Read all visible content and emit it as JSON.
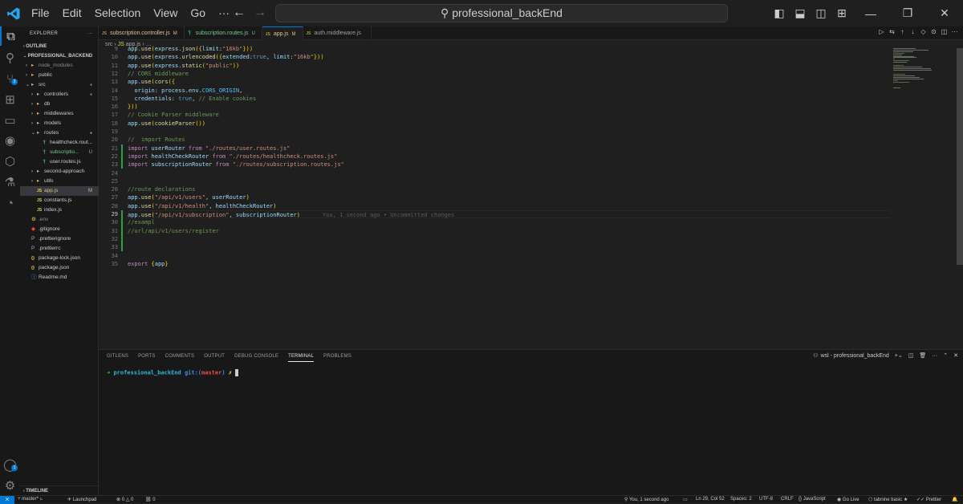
{
  "titlebar": {
    "menu": [
      "File",
      "Edit",
      "Selection",
      "View",
      "Go",
      "···"
    ],
    "search": "professional_backEnd"
  },
  "activitybar": {
    "badge_scm": "3",
    "badge_account": "1"
  },
  "explorer": {
    "header": "EXPLORER",
    "outline": "OUTLINE",
    "project": "PROFESSIONAL_BACKEND",
    "timeline": "TIMELINE",
    "tree": [
      {
        "label": "node_modules",
        "indent": 1,
        "type": "folder",
        "chev": "›",
        "color": "#8c8c8c"
      },
      {
        "label": "public",
        "indent": 1,
        "type": "folder",
        "chev": "›"
      },
      {
        "label": "src",
        "indent": 1,
        "type": "folder",
        "chev": "⌄",
        "dot": "#c27d5a"
      },
      {
        "label": "controllers",
        "indent": 2,
        "type": "folder",
        "chev": "›",
        "dot": "#c27d5a"
      },
      {
        "label": "db",
        "indent": 2,
        "type": "folder",
        "chev": "›"
      },
      {
        "label": "middlewares",
        "indent": 2,
        "type": "folder",
        "chev": "›"
      },
      {
        "label": "models",
        "indent": 2,
        "type": "folder",
        "chev": "›"
      },
      {
        "label": "routes",
        "indent": 2,
        "type": "folder",
        "chev": "⌄",
        "dot": "#73c991"
      },
      {
        "label": "healthcheck.rout...",
        "indent": 3,
        "type": "js-route"
      },
      {
        "label": "subscriptio...",
        "indent": 3,
        "type": "js-route",
        "badge": "U",
        "badge_color": "#73c991",
        "color": "#73c991"
      },
      {
        "label": "user.routes.js",
        "indent": 3,
        "type": "js-route"
      },
      {
        "label": "second-approach",
        "indent": 2,
        "type": "folder",
        "chev": "›"
      },
      {
        "label": "utils",
        "indent": 2,
        "type": "folder",
        "chev": "›"
      },
      {
        "label": "app.js",
        "indent": 2,
        "type": "js",
        "badge": "M",
        "badge_color": "#e2c08d",
        "color": "#e2c08d",
        "selected": true
      },
      {
        "label": "constants.js",
        "indent": 2,
        "type": "js"
      },
      {
        "label": "index.js",
        "indent": 2,
        "type": "js"
      },
      {
        "label": ".env",
        "indent": 1,
        "type": "env",
        "color": "#8c8c8c"
      },
      {
        "label": ".gitignore",
        "indent": 1,
        "type": "git"
      },
      {
        "label": ".prettierignore",
        "indent": 1,
        "type": "prettier"
      },
      {
        "label": ".prettierrc",
        "indent": 1,
        "type": "prettier"
      },
      {
        "label": "package-lock.json",
        "indent": 1,
        "type": "json"
      },
      {
        "label": "package.json",
        "indent": 1,
        "type": "json"
      },
      {
        "label": "Readme.md",
        "indent": 1,
        "type": "md"
      }
    ]
  },
  "tabs": [
    {
      "label": "subscription.controller.js",
      "status": "M",
      "icon": "js"
    },
    {
      "label": "subscription.routes.js",
      "status": "U",
      "icon": "route"
    },
    {
      "label": "app.js",
      "status": "M",
      "icon": "js",
      "active": true
    },
    {
      "label": "auth.middleware.js",
      "status": "",
      "icon": "js"
    }
  ],
  "breadcrumb": {
    "folder": "src",
    "file": "app.js",
    "rest": "…"
  },
  "code": {
    "current_line": "29",
    "blame": "You, 1 second ago • Uncommitted changes",
    "lines": [
      {
        "n": "9",
        "t": "app.use(express.json({limit:\"16kb\"}))"
      },
      {
        "n": "10",
        "t": "app.use(express.urlencoded({extended:true, limit:\"16kb\"}))"
      },
      {
        "n": "11",
        "t": "app.use(express.static(\"public\"))"
      },
      {
        "n": "12",
        "t": "// CORS middleware"
      },
      {
        "n": "13",
        "t": "app.use(cors({"
      },
      {
        "n": "14",
        "t": "  origin: process.env.CORS_ORIGIN,"
      },
      {
        "n": "15",
        "t": "  credentials: true, // Enable cookies"
      },
      {
        "n": "16",
        "t": "}))"
      },
      {
        "n": "17",
        "t": "// Cookie Parser middleware"
      },
      {
        "n": "18",
        "t": "app.use(cookieParser())"
      },
      {
        "n": "19",
        "t": ""
      },
      {
        "n": "20",
        "t": "//  import Routes"
      },
      {
        "n": "21",
        "t": "import userRouter from \"./routes/user.routes.js\""
      },
      {
        "n": "22",
        "t": "import healthCheckRouter from \"./routes/healthcheck.routes.js\""
      },
      {
        "n": "23",
        "t": "import subscriptionRouter from \"./routes/subscription.routes.js\""
      },
      {
        "n": "24",
        "t": ""
      },
      {
        "n": "25",
        "t": ""
      },
      {
        "n": "26",
        "t": "//route declarations"
      },
      {
        "n": "27",
        "t": "app.use(\"/api/v1/users\", userRouter)"
      },
      {
        "n": "28",
        "t": "app.use(\"/api/v1/health\", healthCheckRouter)"
      },
      {
        "n": "29",
        "t": "app.use(\"/api/v1/subscription\", subscriptionRouter)"
      },
      {
        "n": "30",
        "t": "//exampl"
      },
      {
        "n": "31",
        "t": "//url/api/v1/users/register"
      },
      {
        "n": "32",
        "t": ""
      },
      {
        "n": "33",
        "t": ""
      },
      {
        "n": "34",
        "t": ""
      },
      {
        "n": "35",
        "t": "export {app}"
      }
    ]
  },
  "panel": {
    "tabs": [
      "GITLENS",
      "PORTS",
      "COMMENTS",
      "OUTPUT",
      "DEBUG CONSOLE",
      "TERMINAL",
      "PROBLEMS"
    ],
    "active_tab": "TERMINAL",
    "terminal_name": "wsl - professional_backEnd",
    "prompt": {
      "arrow": "➜",
      "dir": "professional_backEnd",
      "git": "git:(",
      "branch": "master",
      ")": ")",
      "mark": "✗"
    }
  },
  "statusbar": {
    "branch": "master*",
    "launchpad": "Launchpad",
    "errors": "0",
    "warnings": "0",
    "ports": "0",
    "blame": "You, 1 second ago",
    "position": "Ln 29, Col 52",
    "spaces": "Spaces: 2",
    "encoding": "UTF-8",
    "eol": "CRLF",
    "language": "JavaScript",
    "golive": "Go Live",
    "tabnine": "tabnine basic",
    "prettier": "Prettier"
  },
  "colors": {
    "accent": "#0078d4",
    "added": "#2ea043",
    "modified": "#e2c08d",
    "untracked": "#73c991"
  }
}
